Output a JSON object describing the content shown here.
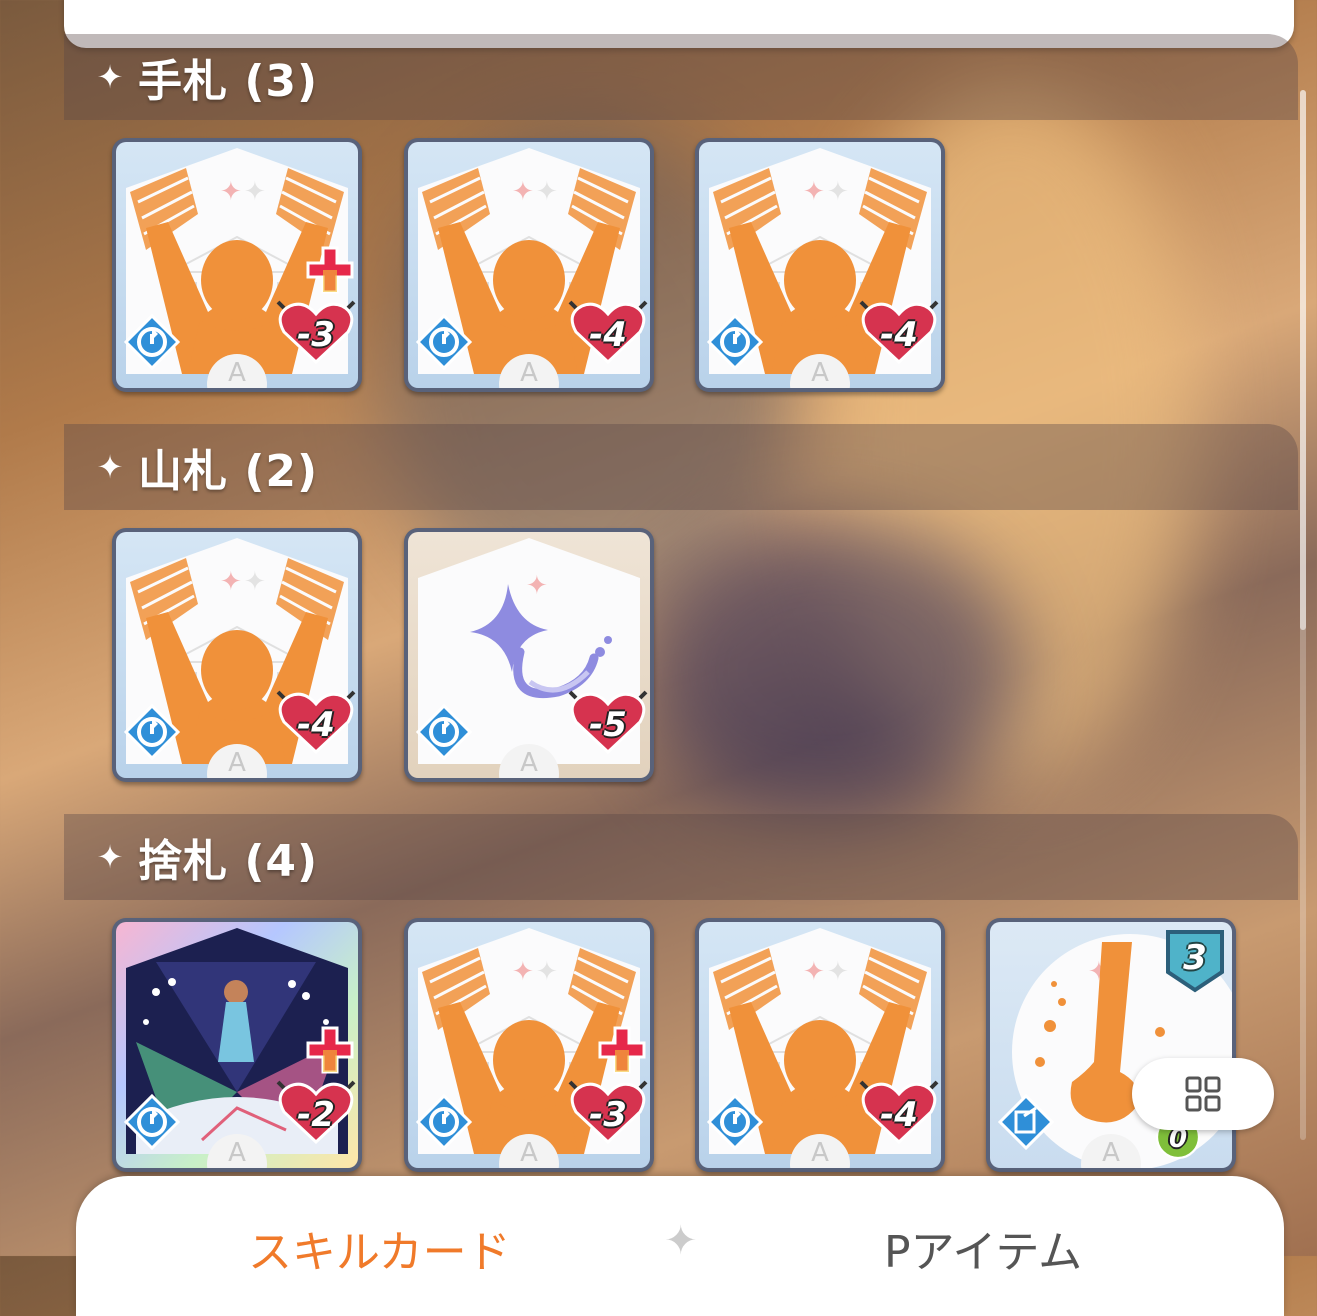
{
  "sections": [
    {
      "title": "手札 (3)",
      "cards": [
        {
          "cost": "-3",
          "variant": "cheer",
          "plus": true
        },
        {
          "cost": "-4",
          "variant": "cheer",
          "plus": false
        },
        {
          "cost": "-4",
          "variant": "cheer",
          "plus": false
        }
      ]
    },
    {
      "title": "山札 (2)",
      "cards": [
        {
          "cost": "-4",
          "variant": "cheer",
          "plus": false
        },
        {
          "cost": "-5",
          "variant": "sparkle",
          "plus": false
        }
      ]
    },
    {
      "title": "捨札 (4)",
      "cards": [
        {
          "cost": "-2",
          "variant": "stage",
          "plus": true
        },
        {
          "cost": "-3",
          "variant": "cheer",
          "plus": true
        },
        {
          "cost": "-4",
          "variant": "cheer",
          "plus": false
        },
        {
          "cost": "0",
          "variant": "kick",
          "plus": false,
          "level": "3"
        }
      ]
    }
  ],
  "rarity_letter": "A",
  "tabs": {
    "active": "スキルカード",
    "inactive": "Pアイテム"
  },
  "section_icon": "sparkle-icon",
  "colors": {
    "accent": "#f07a2a",
    "card_orange": "#f0913a",
    "cost_red": "#d6334f"
  }
}
